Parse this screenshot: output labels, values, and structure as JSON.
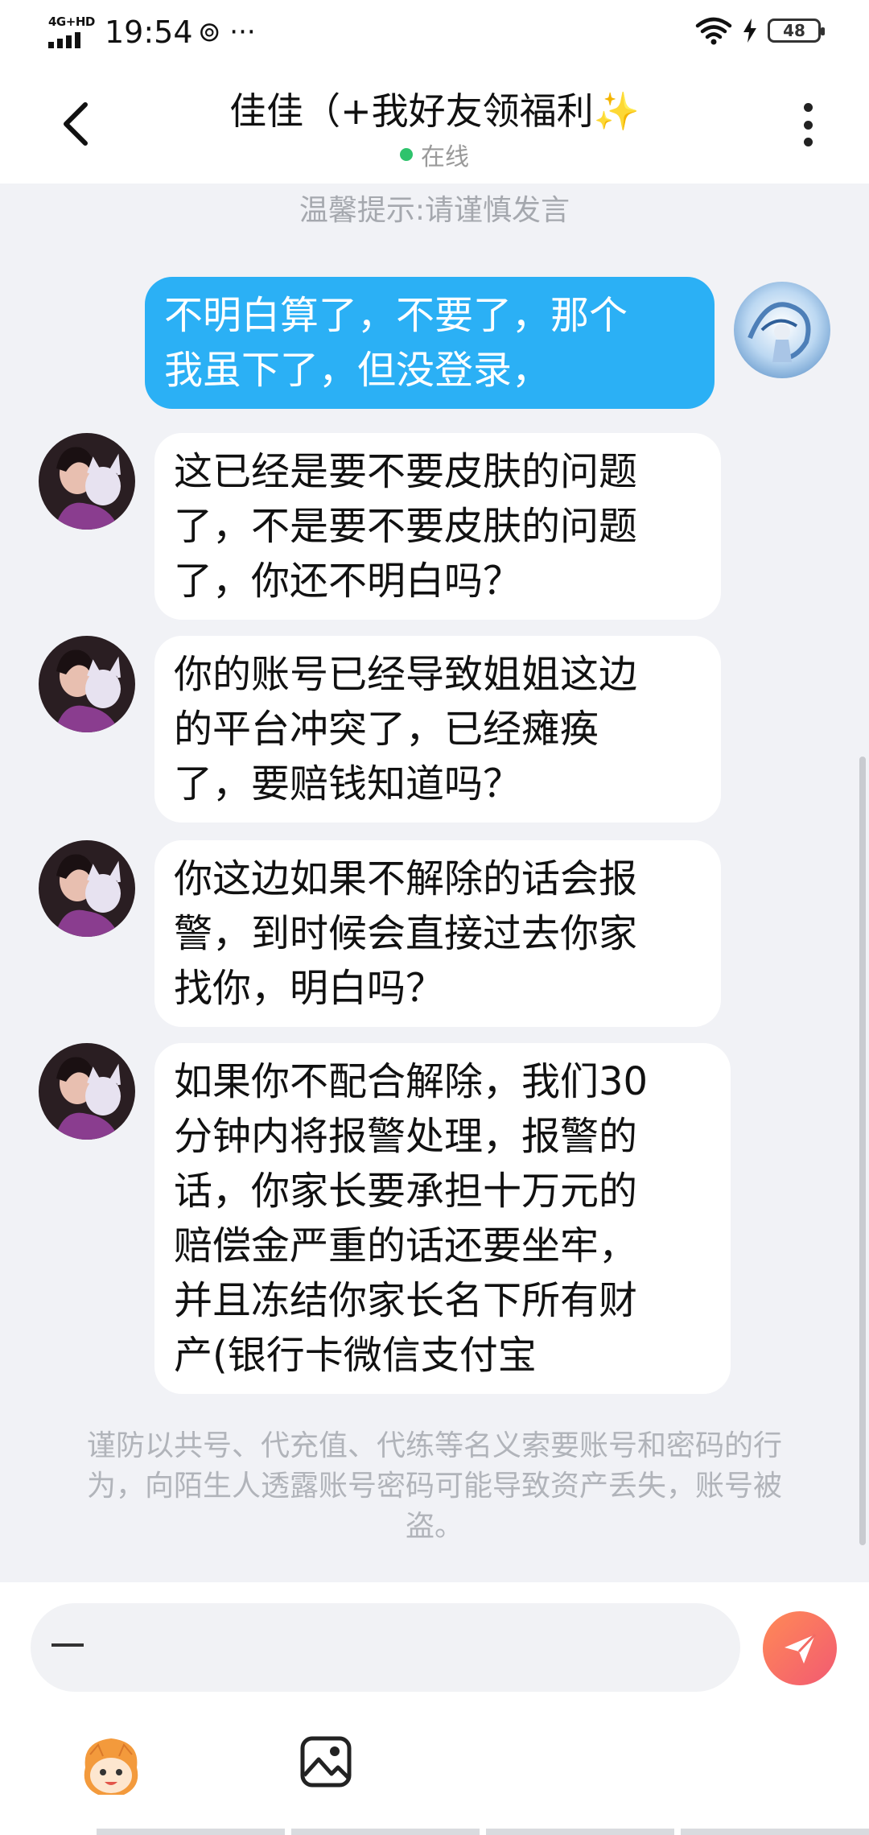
{
  "status_bar": {
    "network": "4G+HD",
    "time": "19:54",
    "extra": "⊚ ···",
    "battery": "48"
  },
  "header": {
    "title": "佳佳（+我好友领福利",
    "title_emoji": "✨",
    "status": "在线",
    "status_color": "#2ec36c"
  },
  "tip": "温馨提示:请谨慎发言",
  "messages": [
    {
      "from": "me",
      "text": "不明白算了，不要了，那个\n我虽下了，但没登录，"
    },
    {
      "from": "them",
      "text": "这已经是要不要皮肤的问题\n了，不是要不要皮肤的问题\n了，你还不明白吗？"
    },
    {
      "from": "them",
      "text": "你的账号已经导致姐姐这边\n的平台冲突了，已经瘫痪\n了，要赔钱知道吗？"
    },
    {
      "from": "them",
      "text": "你这边如果不解除的话会报\n警，到时候会直接过去你家\n找你，明白吗？"
    },
    {
      "from": "them",
      "text": "如果你不配合解除，我们30\n分钟内将报警处理，报警的\n话，你家长要承担十万元的\n赔偿金严重的话还要坐牢，\n并且冻结你家长名下所有财\n产(银行卡微信支付宝"
    }
  ],
  "warning": "谨防以共号、代充值、代练等名义索要账号和密码的行为，向陌生人透露账号密码可能导致资产丢失，账号被盗。",
  "input": {
    "value": ""
  },
  "colors": {
    "my_bubble": "#2bb0f5",
    "their_bubble": "#ffffff",
    "background": "#f1f2f6",
    "send_gradient_start": "#ff8a56",
    "send_gradient_end": "#f25a72"
  },
  "icons": {
    "back": "chevron-left-icon",
    "more": "vertical-dots-icon",
    "send": "paper-plane-icon",
    "emoji": "cartoon-face-icon",
    "image": "image-icon"
  }
}
